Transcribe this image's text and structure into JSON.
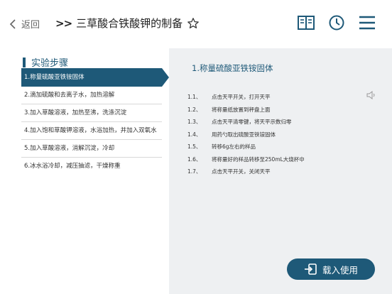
{
  "header": {
    "back_label": "返回",
    "title_prefix": ">>",
    "title": "三草酸合铁酸钾的制备"
  },
  "left": {
    "section_title": "实验步骤",
    "steps": [
      "1.称量硫酸亚铁铵固体",
      "2.滴加硫酸和去离子水，加热溶解",
      "3.加入草酸溶液，加热至沸，洗涤沉淀",
      "4.加入饱和草酸钾溶液，水浴加热，并加入双氧水",
      "5.加入草酸溶液，消解沉淀，冷却",
      "6.冰水浴冷却，减压抽滤，干燥称重"
    ]
  },
  "right": {
    "title": "1.称量硫酸亚铁铵固体",
    "substeps": [
      {
        "no": "1.1、",
        "text": "点击天平开关，打开天平"
      },
      {
        "no": "1.2、",
        "text": "将称量纸放置到秤盘上面"
      },
      {
        "no": "1.3、",
        "text": "点击天平清零键，将天平示数归零"
      },
      {
        "no": "1.4、",
        "text": "用药勺取出硫酸亚铁铵固体"
      },
      {
        "no": "1.5、",
        "text": "转移6g左右的样品"
      },
      {
        "no": "1.6、",
        "text": "将称量好的样品转移至250mL大烧杯中"
      },
      {
        "no": "1.7、",
        "text": "点击天平开关，关闭天平"
      }
    ]
  },
  "load_button": {
    "label": "载入使用"
  },
  "colors": {
    "accent": "#1e5978",
    "panel_bg": "#eef0f2"
  }
}
